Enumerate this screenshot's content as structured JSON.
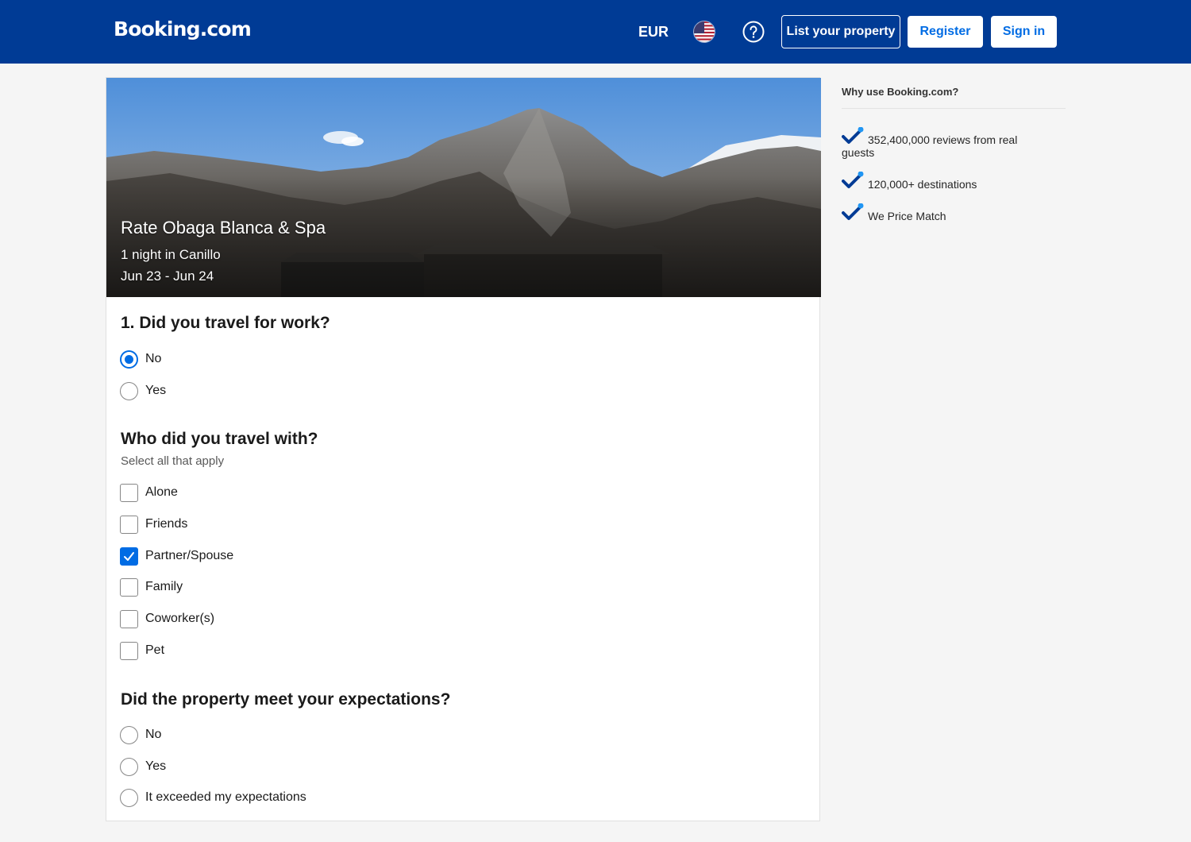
{
  "header": {
    "logo": "Booking.com",
    "currency": "EUR",
    "flag_icon": "us-flag-icon",
    "help_icon": "question-circle-icon",
    "list_property": "List your property",
    "register": "Register",
    "sign_in": "Sign in",
    "colors": {
      "brand": "#003b95",
      "accent": "#006ce4"
    }
  },
  "hero": {
    "title": "Rate Obaga Blanca & Spa",
    "nights": "1 night in Canillo",
    "dates": "Jun 23 - Jun 24"
  },
  "q1": {
    "title": "1. Did you travel for work?",
    "options": [
      {
        "label": "No",
        "checked": true
      },
      {
        "label": "Yes",
        "checked": false
      }
    ]
  },
  "q2": {
    "title": "Who did you travel with?",
    "subtitle": "Select all that apply",
    "options": [
      {
        "label": "Alone",
        "checked": false
      },
      {
        "label": "Friends",
        "checked": false
      },
      {
        "label": "Partner/Spouse",
        "checked": true
      },
      {
        "label": "Family",
        "checked": false
      },
      {
        "label": "Coworker(s)",
        "checked": false
      },
      {
        "label": "Pet",
        "checked": false
      }
    ]
  },
  "q3": {
    "title": "Did the property meet your expectations?",
    "options": [
      {
        "label": "No",
        "checked": false
      },
      {
        "label": "Yes",
        "checked": false
      },
      {
        "label": "It exceeded my expectations",
        "checked": false
      }
    ]
  },
  "sidebar": {
    "title": "Why use Booking.com?",
    "items": [
      "352,400,000 reviews from real guests",
      "120,000+ destinations",
      "We Price Match"
    ]
  }
}
